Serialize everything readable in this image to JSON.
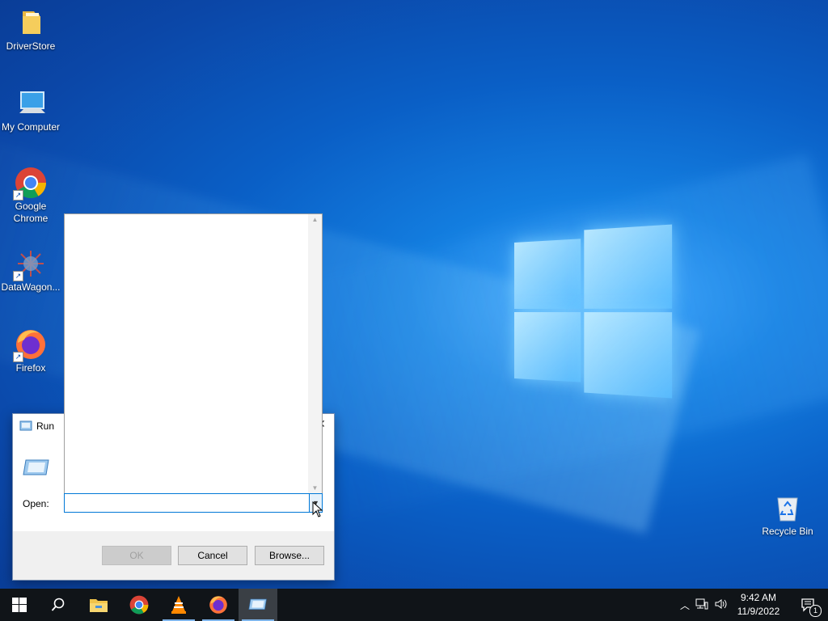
{
  "desktop": {
    "icons": [
      {
        "label": "DriverStore",
        "icon": "folder-icon"
      },
      {
        "label": "My Computer",
        "icon": "computer-icon"
      },
      {
        "label": "Google Chrome",
        "icon": "chrome-icon"
      },
      {
        "label": "DataWagon...",
        "icon": "datawagon-icon"
      },
      {
        "label": "Firefox",
        "icon": "firefox-icon"
      },
      {
        "label": "Recycle Bin",
        "icon": "recycle-bin-icon"
      }
    ]
  },
  "run_dialog": {
    "title": "Run",
    "open_label": "Open:",
    "open_value": "",
    "ok_label": "OK",
    "cancel_label": "Cancel",
    "browse_label": "Browse...",
    "close_glyph": "✕"
  },
  "taskbar": {
    "apps": [
      "start-icon",
      "search-icon",
      "file-explorer-icon",
      "chrome-icon",
      "vlc-icon",
      "firefox-icon",
      "run-icon"
    ],
    "clock_time": "9:42 AM",
    "clock_date": "11/9/2022",
    "notification_count": "1"
  }
}
